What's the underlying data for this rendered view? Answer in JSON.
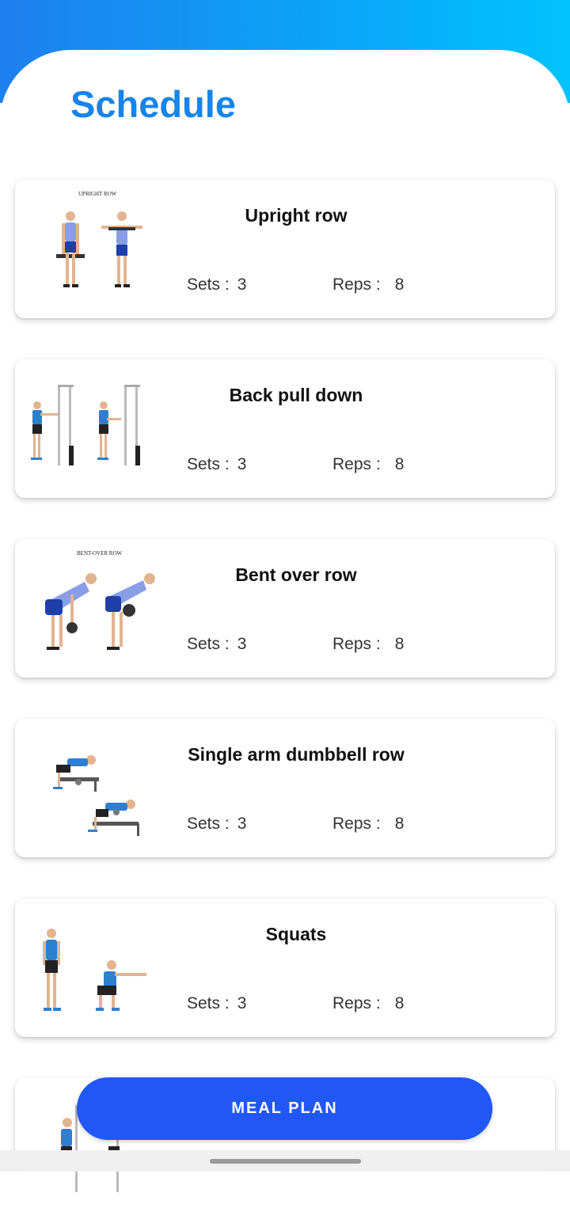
{
  "header": {
    "title": "Schedule"
  },
  "exercises": [
    {
      "name": "Upright row",
      "sets_label": "Sets :",
      "sets": "3",
      "reps_label": "Reps :",
      "reps": "8",
      "image_label": "UPRIGHT ROW",
      "illustration": "upright-row"
    },
    {
      "name": "Back pull down",
      "sets_label": "Sets :",
      "sets": "3",
      "reps_label": "Reps :",
      "reps": "8",
      "illustration": "back-pull-down"
    },
    {
      "name": "Bent over row",
      "sets_label": "Sets :",
      "sets": "3",
      "reps_label": "Reps :",
      "reps": "8",
      "image_label": "BENT-OVER ROW",
      "illustration": "bent-over-row"
    },
    {
      "name": "Single arm dumbbell row",
      "sets_label": "Sets :",
      "sets": "3",
      "reps_label": "Reps :",
      "reps": "8",
      "illustration": "single-arm-dumbbell-row"
    },
    {
      "name": "Squats",
      "sets_label": "Sets :",
      "sets": "3",
      "reps_label": "Reps :",
      "reps": "8",
      "illustration": "squats"
    }
  ],
  "footer": {
    "meal_plan_label": "MEAL PLAN"
  },
  "colors": {
    "title": "#1685ea",
    "button": "#2157f5",
    "header_gradient_start": "#1e7ff0",
    "header_gradient_end": "#02c3fd"
  }
}
